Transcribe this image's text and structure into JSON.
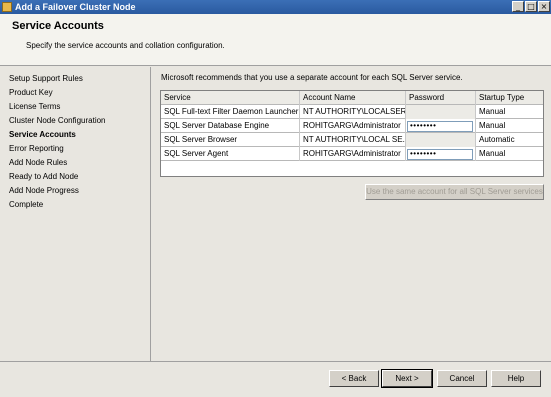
{
  "window": {
    "title": "Add a Failover Cluster Node",
    "controls": [
      "_",
      "□",
      "×"
    ]
  },
  "header": {
    "title": "Service Accounts",
    "subtitle": "Specify the service accounts and collation configuration."
  },
  "sidebar": {
    "items": [
      {
        "label": "Setup Support Rules",
        "active": false
      },
      {
        "label": "Product Key",
        "active": false
      },
      {
        "label": "License Terms",
        "active": false
      },
      {
        "label": "Cluster Node Configuration",
        "active": false
      },
      {
        "label": "Service Accounts",
        "active": true
      },
      {
        "label": "Error Reporting",
        "active": false
      },
      {
        "label": "Add Node Rules",
        "active": false
      },
      {
        "label": "Ready to Add Node",
        "active": false
      },
      {
        "label": "Add Node Progress",
        "active": false
      },
      {
        "label": "Complete",
        "active": false
      }
    ]
  },
  "main": {
    "recommendation": "Microsoft recommends that you use a separate account for each SQL Server service.",
    "table": {
      "columns": [
        "Service",
        "Account Name",
        "Password",
        "Startup Type"
      ],
      "rows": [
        {
          "service": "SQL Full-text Filter Daemon Launcher",
          "account": "NT AUTHORITY\\LOCALSER...",
          "password": "",
          "startup": "Manual"
        },
        {
          "service": "SQL Server Database Engine",
          "account": "ROHITGARG\\Administrator",
          "password": "••••••••",
          "startup": "Manual"
        },
        {
          "service": "SQL Server Browser",
          "account": "NT AUTHORITY\\LOCAL SE...",
          "password": "",
          "startup": "Automatic"
        },
        {
          "service": "SQL Server Agent",
          "account": "ROHITGARG\\Administrator",
          "password": "••••••••",
          "startup": "Manual"
        }
      ]
    },
    "same_account_button": "Use the same account for all SQL Server services"
  },
  "footer": {
    "back": "< Back",
    "next": "Next >",
    "cancel": "Cancel",
    "help": "Help"
  }
}
